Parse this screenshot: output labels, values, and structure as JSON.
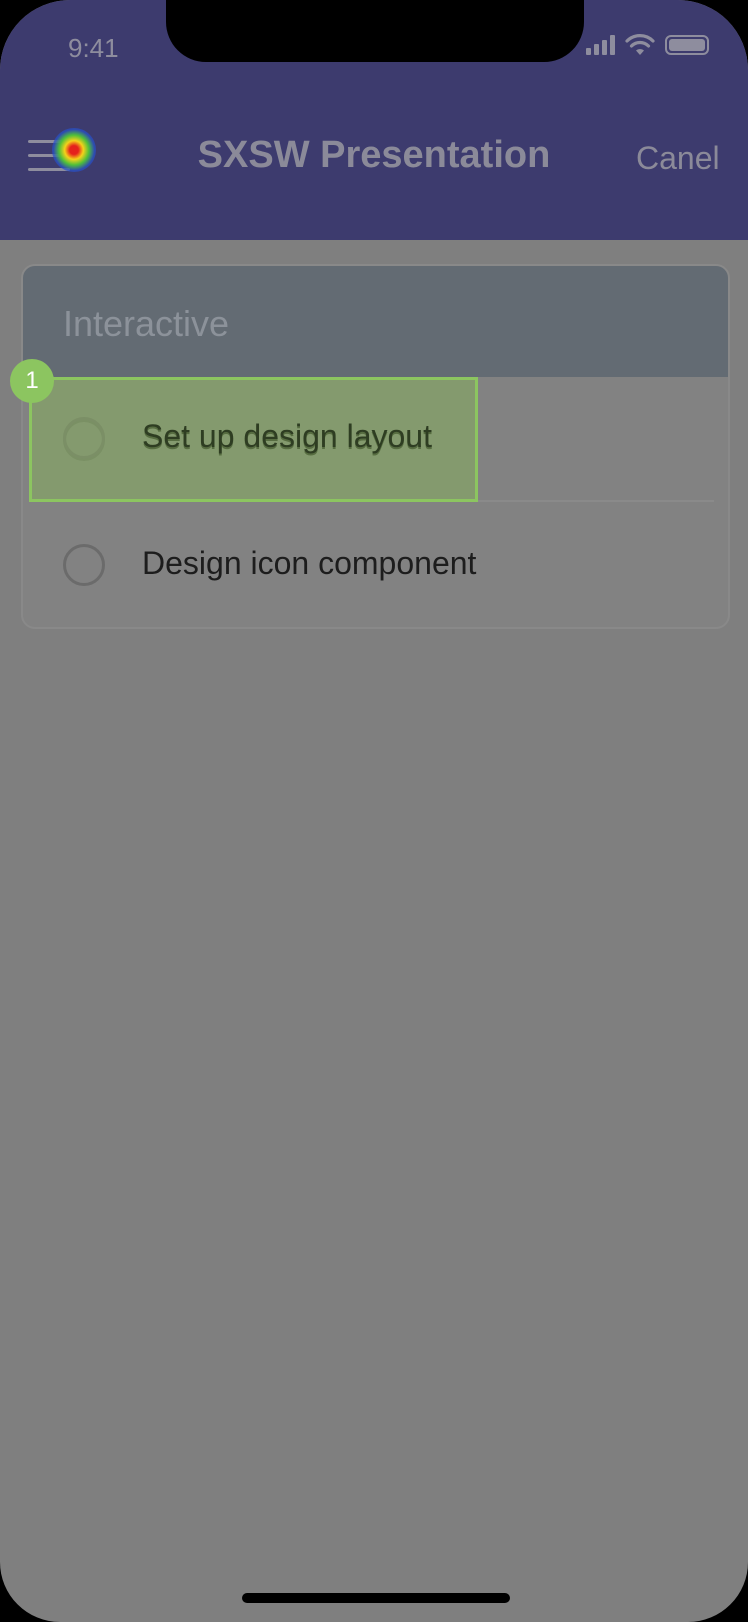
{
  "status_bar": {
    "time": "9:41"
  },
  "header": {
    "title": "SXSW Presentation",
    "cancel_label": "Canel",
    "menu_icon": "hamburger-menu-icon"
  },
  "card": {
    "header_label": "Interactive",
    "items": [
      {
        "label": "Set up design layout",
        "checked": false
      },
      {
        "label": "Design icon component",
        "checked": false
      }
    ]
  },
  "annotation": {
    "step_number": "1",
    "highlight_color": "#8cc560"
  },
  "colors": {
    "navbar": "#3d3b6e",
    "overlay": "#7f7f7f",
    "card_header": "#636b73"
  }
}
